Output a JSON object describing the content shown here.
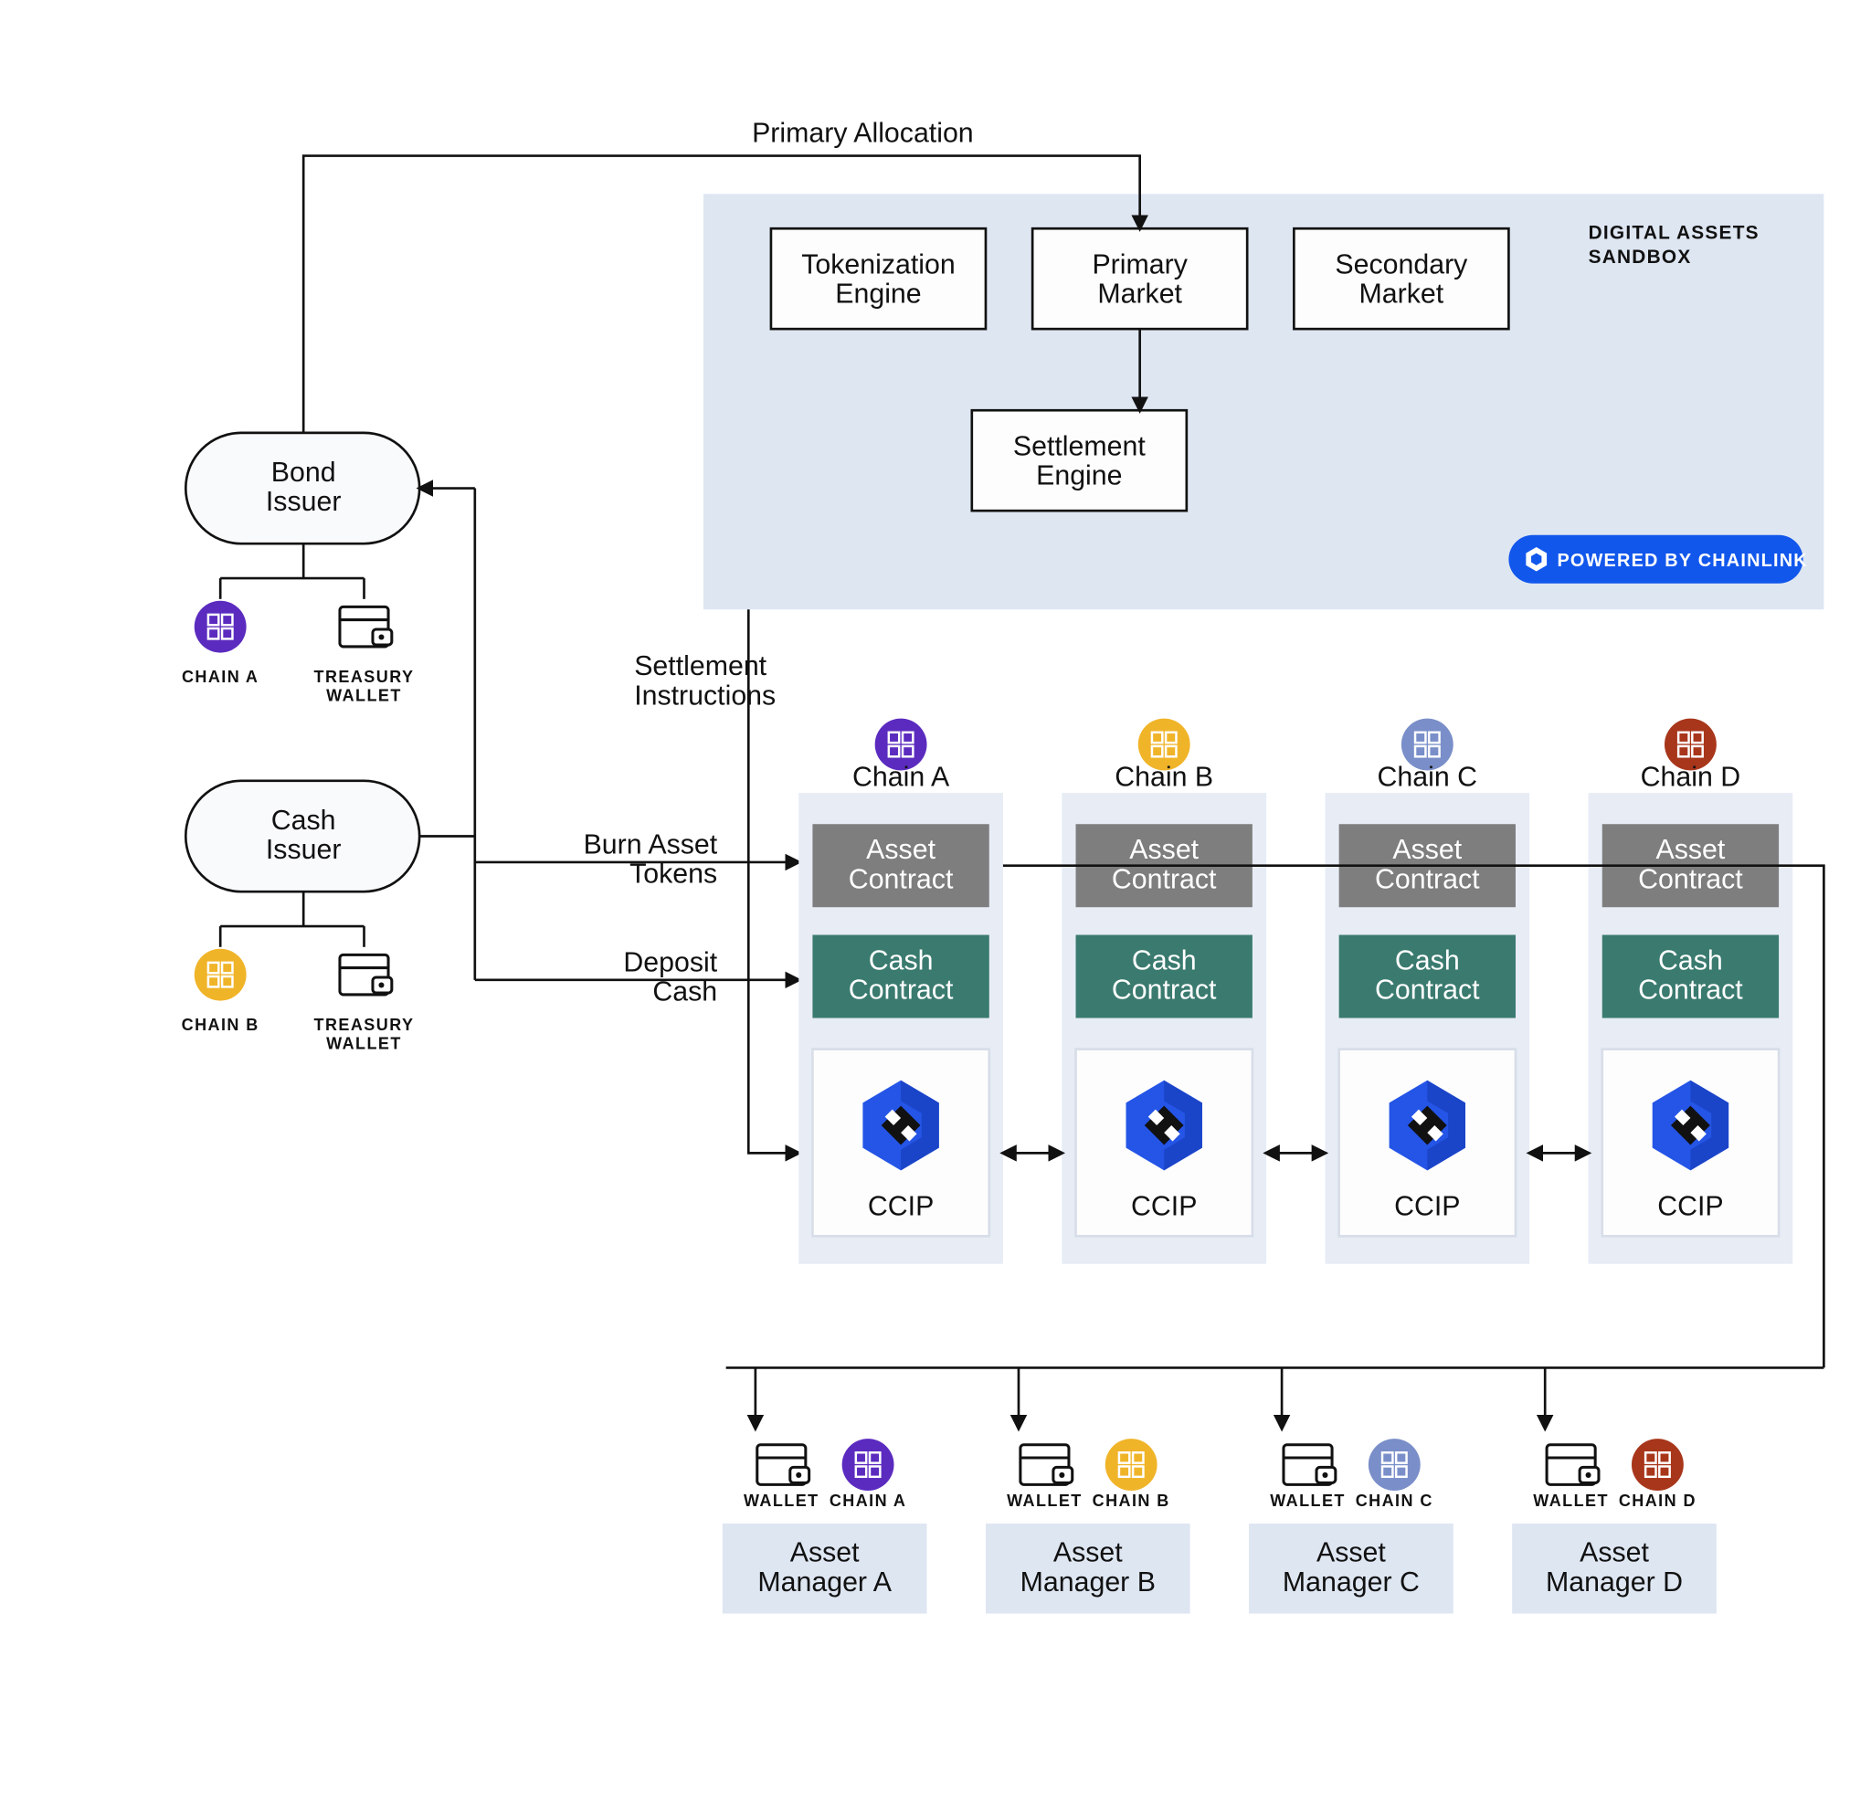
{
  "labels": {
    "primary_allocation": "Primary Allocation",
    "settlement_instructions_l1": "Settlement",
    "settlement_instructions_l2": "Instructions",
    "burn_l1": "Burn Asset",
    "burn_l2": "Tokens",
    "deposit_l1": "Deposit",
    "deposit_l2": "Cash"
  },
  "sandbox": {
    "title_l1": "DIGITAL ASSETS",
    "title_l2": "SANDBOX",
    "tokenization_l1": "Tokenization",
    "tokenization_l2": "Engine",
    "primary_market_l1": "Primary",
    "primary_market_l2": "Market",
    "secondary_market_l1": "Secondary",
    "secondary_market_l2": "Market",
    "settlement_l1": "Settlement",
    "settlement_l2": "Engine",
    "badge": "POWERED BY CHAINLINK"
  },
  "issuers": {
    "bond_l1": "Bond",
    "bond_l2": "Issuer",
    "cash_l1": "Cash",
    "cash_l2": "Issuer",
    "chain_a": "CHAIN A",
    "chain_b": "CHAIN B",
    "treasury_l1": "TREASURY",
    "treasury_l2": "WALLET"
  },
  "chains": [
    {
      "name": "Chain A",
      "icon_color": "#5b2bbf",
      "amgr_l1": "Asset",
      "amgr_l2": "Manager A",
      "amgr_chain": "CHAIN A"
    },
    {
      "name": "Chain B",
      "icon_color": "#f0b429",
      "amgr_l1": "Asset",
      "amgr_l2": "Manager B",
      "amgr_chain": "CHAIN B"
    },
    {
      "name": "Chain C",
      "icon_color": "#7a8fc9",
      "amgr_l1": "Asset",
      "amgr_l2": "Manager C",
      "amgr_chain": "CHAIN C"
    },
    {
      "name": "Chain D",
      "icon_color": "#a8361b",
      "amgr_l1": "Asset",
      "amgr_l2": "Manager D",
      "amgr_chain": "CHAIN D"
    }
  ],
  "chain_box": {
    "asset_l1": "Asset",
    "asset_l2": "Contract",
    "cash_l1": "Cash",
    "cash_l2": "Contract",
    "ccip": "CCIP"
  },
  "amgr": {
    "wallet": "WALLET"
  },
  "colors": {
    "purple": "#5b2bbf",
    "yellow": "#f0b429"
  }
}
